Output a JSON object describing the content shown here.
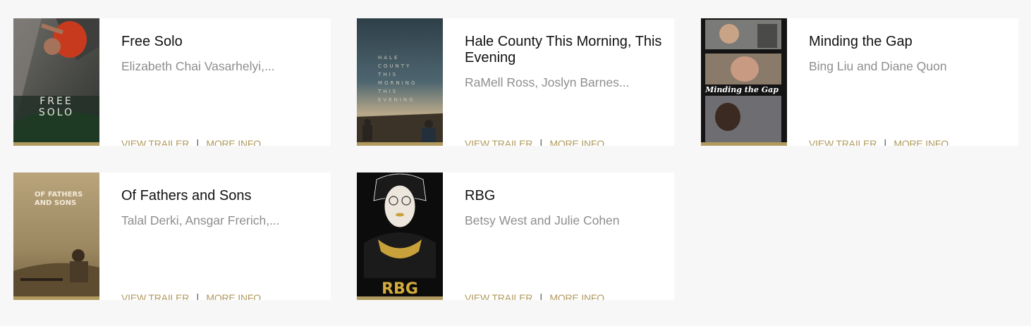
{
  "films": [
    {
      "title": "Free Solo",
      "credits": "Elizabeth Chai Vasarhelyi,...",
      "poster_text": "FREE\nSOLO",
      "view_trailer": "VIEW TRAILER",
      "separator": "|",
      "more_info": "MORE INFO"
    },
    {
      "title": "Hale County This Morning, This Evening",
      "credits": "RaMell Ross, Joslyn Barnes...",
      "poster_text": "HALE COUNTY THIS MORNING THIS EVENING",
      "view_trailer": "VIEW TRAILER",
      "separator": "|",
      "more_info": "MORE INFO"
    },
    {
      "title": "Minding the Gap",
      "credits": "Bing Liu and Diane Quon",
      "poster_text": "Minding the Gap",
      "view_trailer": "VIEW TRAILER",
      "separator": "|",
      "more_info": "MORE INFO"
    },
    {
      "title": "Of Fathers and Sons",
      "credits": "Talal Derki, Ansgar Frerich,...",
      "poster_text": "OF FATHERS AND SONS",
      "view_trailer": "VIEW TRAILER",
      "separator": "|",
      "more_info": "MORE INFO"
    },
    {
      "title": "RBG",
      "credits": "Betsy West and Julie Cohen",
      "poster_text": "RBG",
      "view_trailer": "VIEW TRAILER",
      "separator": "|",
      "more_info": "MORE INFO"
    }
  ],
  "colors": {
    "accent_gold": "#b09a5e",
    "title_text": "#111111",
    "credits_text": "#8e8e8e",
    "page_bg": "#f7f7f7",
    "card_bg": "#ffffff"
  }
}
